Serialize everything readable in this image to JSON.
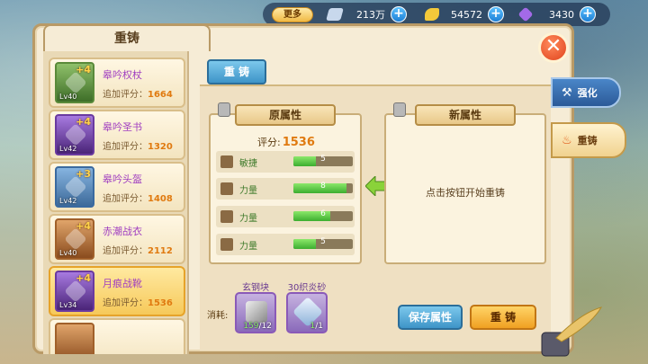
{
  "topbar": {
    "more_label": "更多",
    "currencies": [
      {
        "icon": "silver-gem-icon",
        "value": "213万",
        "color": "#c8d8ec"
      },
      {
        "icon": "gold-leaf-icon",
        "value": "54572",
        "color": "#f3c93a"
      },
      {
        "icon": "purple-crystal-icon",
        "value": "3430",
        "color": "#a36ae8"
      }
    ]
  },
  "window": {
    "title": "重铸",
    "close_glyph": "✕"
  },
  "side_tabs": [
    {
      "label": "强化",
      "icon": "hammer-icon"
    },
    {
      "label": "重铸",
      "icon": "fire-icon"
    }
  ],
  "item_list": [
    {
      "name": "皋吟权杖",
      "level": "Lv40",
      "plus": "+4",
      "score_label": "追加评分：",
      "score": "1664",
      "rarity": "purple"
    },
    {
      "name": "皋吟圣书",
      "level": "Lv42",
      "plus": "+4",
      "score_label": "追加评分：",
      "score": "1320",
      "rarity": "purple"
    },
    {
      "name": "皋吟头盔",
      "level": "Lv42",
      "plus": "+3",
      "score_label": "追加评分：",
      "score": "1408",
      "rarity": "blue"
    },
    {
      "name": "赤潮战衣",
      "level": "Lv40",
      "plus": "+4",
      "score_label": "追加评分：",
      "score": "2112",
      "rarity": "orange"
    },
    {
      "name": "月痕战靴",
      "level": "Lv34",
      "plus": "+4",
      "score_label": "追加评分：",
      "score": "1536",
      "rarity": "purple"
    }
  ],
  "main_tab": "重 铸",
  "original": {
    "title": "原属性",
    "score_label": "评分:",
    "score": "1536",
    "attributes": [
      {
        "name": "敏捷",
        "value": "5",
        "fill": 0.38
      },
      {
        "name": "力量",
        "value": "8",
        "fill": 0.9
      },
      {
        "name": "力量",
        "value": "6",
        "fill": 0.62
      },
      {
        "name": "力量",
        "value": "5",
        "fill": 0.38
      }
    ]
  },
  "new_attrs": {
    "title": "新属性",
    "hint": "点击按钮开始重铸"
  },
  "consume": {
    "label": "消耗:",
    "materials": [
      {
        "name": "玄钢块",
        "have": "159",
        "need": "/12"
      },
      {
        "name": "30织炎砂",
        "have": "1",
        "need": "/1"
      }
    ]
  },
  "buttons": {
    "save": "保存属性",
    "reforge": "重 铸"
  }
}
